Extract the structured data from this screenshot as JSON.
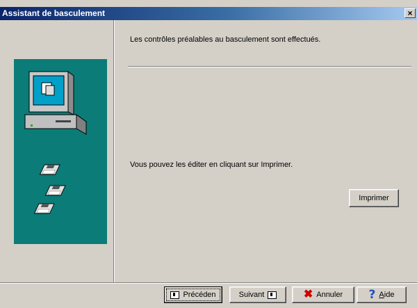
{
  "window": {
    "title": "Assistant de basculement",
    "close_label": "×"
  },
  "content": {
    "message_top": "Les contrôles préalables au basculement sont effectués.",
    "message_print": "Vous pouvez les éditer en cliquant sur Imprimer.",
    "print_button": "Imprimer"
  },
  "nav": {
    "previous": {
      "label": "Précéden",
      "icon": "back-page-icon"
    },
    "next": {
      "label": "Suivant",
      "icon": "forward-page-icon"
    },
    "cancel": {
      "label": "Annuler",
      "icon": "red-x-icon"
    },
    "help": {
      "label_first": "A",
      "label_rest": "ide",
      "icon": "question-mark-icon"
    }
  },
  "colors": {
    "illustration_bg": "#0b7c78",
    "titlebar_start": "#0a246a",
    "face": "#d4d0c8"
  }
}
